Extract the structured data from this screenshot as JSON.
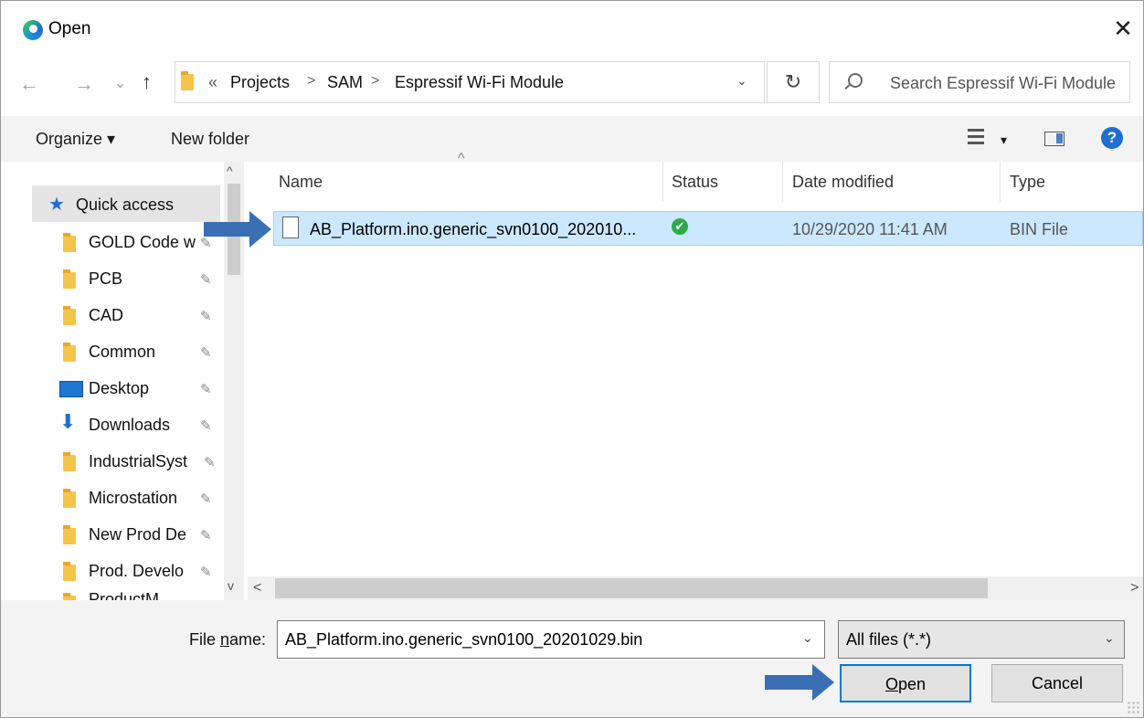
{
  "window": {
    "title": "Open",
    "close_glyph": "✕"
  },
  "address": {
    "overflow": "«",
    "crumbs": [
      "Projects",
      "SAM",
      "Espressif Wi-Fi Module"
    ],
    "separator": ">",
    "dropdown_glyph": "⌄",
    "refresh_glyph": "↻",
    "search_placeholder": "Search Espressif Wi-Fi Module"
  },
  "nav_arrows": {
    "back": "←",
    "forward": "→",
    "recent": "⌄",
    "up": "↑"
  },
  "toolbar": {
    "organize": "Organize ▾",
    "new_folder": "New folder",
    "view_dropdown": "▾",
    "help": "?"
  },
  "sidebar": {
    "quick_access": "Quick access",
    "items": [
      {
        "label": "GOLD Code w",
        "icon": "folder-icon"
      },
      {
        "label": "PCB",
        "icon": "folder-icon"
      },
      {
        "label": "CAD",
        "icon": "network-folder-icon"
      },
      {
        "label": "Common",
        "icon": "network-folder-icon"
      },
      {
        "label": "Desktop",
        "icon": "desktop-icon"
      },
      {
        "label": "Downloads",
        "icon": "downloads-icon"
      },
      {
        "label": "IndustrialSyst",
        "icon": "network-folder-icon"
      },
      {
        "label": "Microstation",
        "icon": "network-folder-icon"
      },
      {
        "label": "New Prod De",
        "icon": "network-folder-icon"
      },
      {
        "label": "Prod. Develo",
        "icon": "network-folder-icon"
      },
      {
        "label": "ProductM",
        "icon": "network-folder-icon"
      }
    ],
    "pin_glyph": "📌"
  },
  "columns": {
    "name": "Name",
    "status": "Status",
    "date": "Date modified",
    "type": "Type",
    "sort_glyph": "^"
  },
  "files": [
    {
      "name": "AB_Platform.ino.generic_svn0100_202010...",
      "status": "synced",
      "date": "10/29/2020 11:41 AM",
      "type": "BIN File"
    }
  ],
  "scroll": {
    "left": "<",
    "right": ">",
    "up": "^",
    "down": "v"
  },
  "footer": {
    "file_name_label_pre": "File ",
    "file_name_label_accel": "n",
    "file_name_label_post": "ame:",
    "file_name_value": "AB_Platform.ino.generic_svn0100_20201029.bin",
    "file_type": "All files (*.*)",
    "open_accel": "O",
    "open_rest": "pen",
    "cancel": "Cancel",
    "dropdown_glyph": "⌄"
  },
  "colors": {
    "selection": "#cce8ff",
    "accent": "#0078d7",
    "arrow": "#3a6fb4",
    "status_ok": "#2eaa4a"
  }
}
